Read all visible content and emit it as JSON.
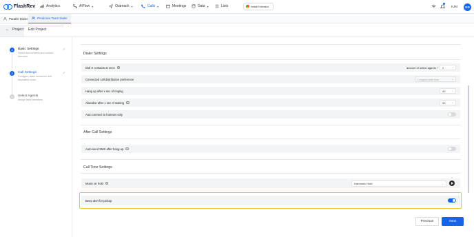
{
  "app": {
    "logo_text": "FlashRev"
  },
  "topnav": {
    "items": [
      {
        "label": "Analytics",
        "icon": "analytics-icon"
      },
      {
        "label": "AIFlow",
        "icon": "flow-icon"
      },
      {
        "label": "Outreach",
        "icon": "send-icon"
      },
      {
        "label": "Calls",
        "icon": "phone-icon"
      },
      {
        "label": "Meetings",
        "icon": "calendar-icon"
      },
      {
        "label": "Data",
        "icon": "database-icon"
      },
      {
        "label": "Lists",
        "icon": "list-icon"
      }
    ],
    "install_label": "Install Extension",
    "user_initials": "KJM",
    "avatar_initials": "KD",
    "accent": "#1565e8"
  },
  "subtabs": [
    {
      "label": "Parallel Dialer"
    },
    {
      "label": "Predictive Team Dialer"
    }
  ],
  "breadcrumb": {
    "back_label": "Project",
    "current": "Edit Project"
  },
  "steps": [
    {
      "num": "1",
      "title": "Basic Settings",
      "desc": "Select dial numbers and contact list/notes"
    },
    {
      "num": "2",
      "title": "Call Settings",
      "desc": "Configure dialer behaviors and disposition rules"
    },
    {
      "num": "3",
      "title": "Select Agents",
      "desc": "Assign team members"
    }
  ],
  "dialer": {
    "title": "Dialer Settings",
    "dial_x": {
      "label": "Dial X contacts at once",
      "right_label": "amount of online agents *",
      "value": "2"
    },
    "distribution": {
      "label": "Connected call distribution preference",
      "value": "Longest wait time"
    },
    "hangup": {
      "label": "Hang up after x sec of ringing",
      "value": "40"
    },
    "abandon": {
      "label": "Abandon after x sec of waiting",
      "value": "30"
    },
    "auto_connect": {
      "label": "Auto connect to humans only"
    }
  },
  "after_call": {
    "title": "After Call Settings",
    "sms": {
      "label": "Auto-send SMS after hang-up"
    }
  },
  "call_tone": {
    "title": "Call Tone Settings",
    "music": {
      "label": "Music on hold",
      "value": "Harmonic Hold"
    },
    "beep": {
      "label": "Beep alert for pickup",
      "enabled": true
    }
  },
  "footer": {
    "previous": "Previous",
    "next": "Next"
  }
}
